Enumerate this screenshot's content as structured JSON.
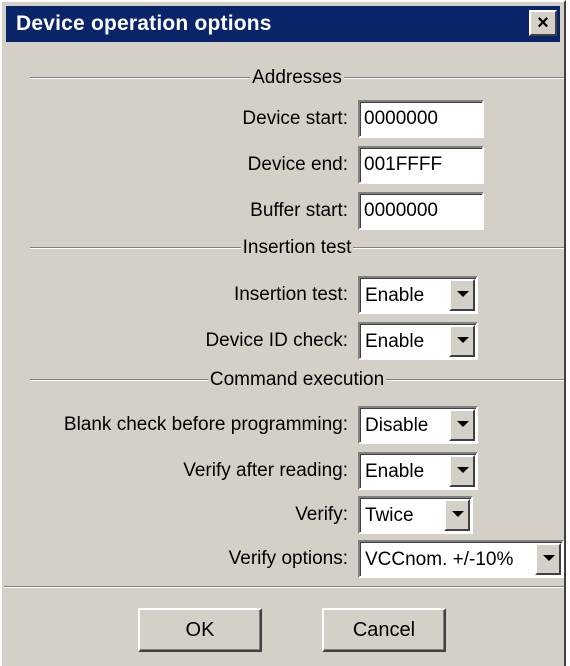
{
  "dialog": {
    "title": "Device operation options",
    "close_icon": "close-icon",
    "close_glyph": "×"
  },
  "sections": {
    "addresses": "Addresses",
    "insertion": "Insertion test",
    "command": "Command execution"
  },
  "fields": {
    "device_start": {
      "label": "Device start:",
      "value": "0000000"
    },
    "device_end": {
      "label": "Device end:",
      "value": "001FFFF"
    },
    "buffer_start": {
      "label": "Buffer start:",
      "value": "0000000"
    },
    "insertion_test": {
      "label": "Insertion test:",
      "value": "Enable"
    },
    "device_id_check": {
      "label": "Device ID check:",
      "value": "Enable"
    },
    "blank_check": {
      "label": "Blank check before programming:",
      "value": "Disable"
    },
    "verify_after_reading": {
      "label": "Verify after reading:",
      "value": "Enable"
    },
    "verify": {
      "label": "Verify:",
      "value": "Twice"
    },
    "verify_options": {
      "label": "Verify options:",
      "value": "VCCnom. +/-10%"
    }
  },
  "buttons": {
    "ok": "OK",
    "cancel": "Cancel"
  },
  "colors": {
    "titlebar": "#0a246a",
    "face": "#d4d0c8"
  }
}
